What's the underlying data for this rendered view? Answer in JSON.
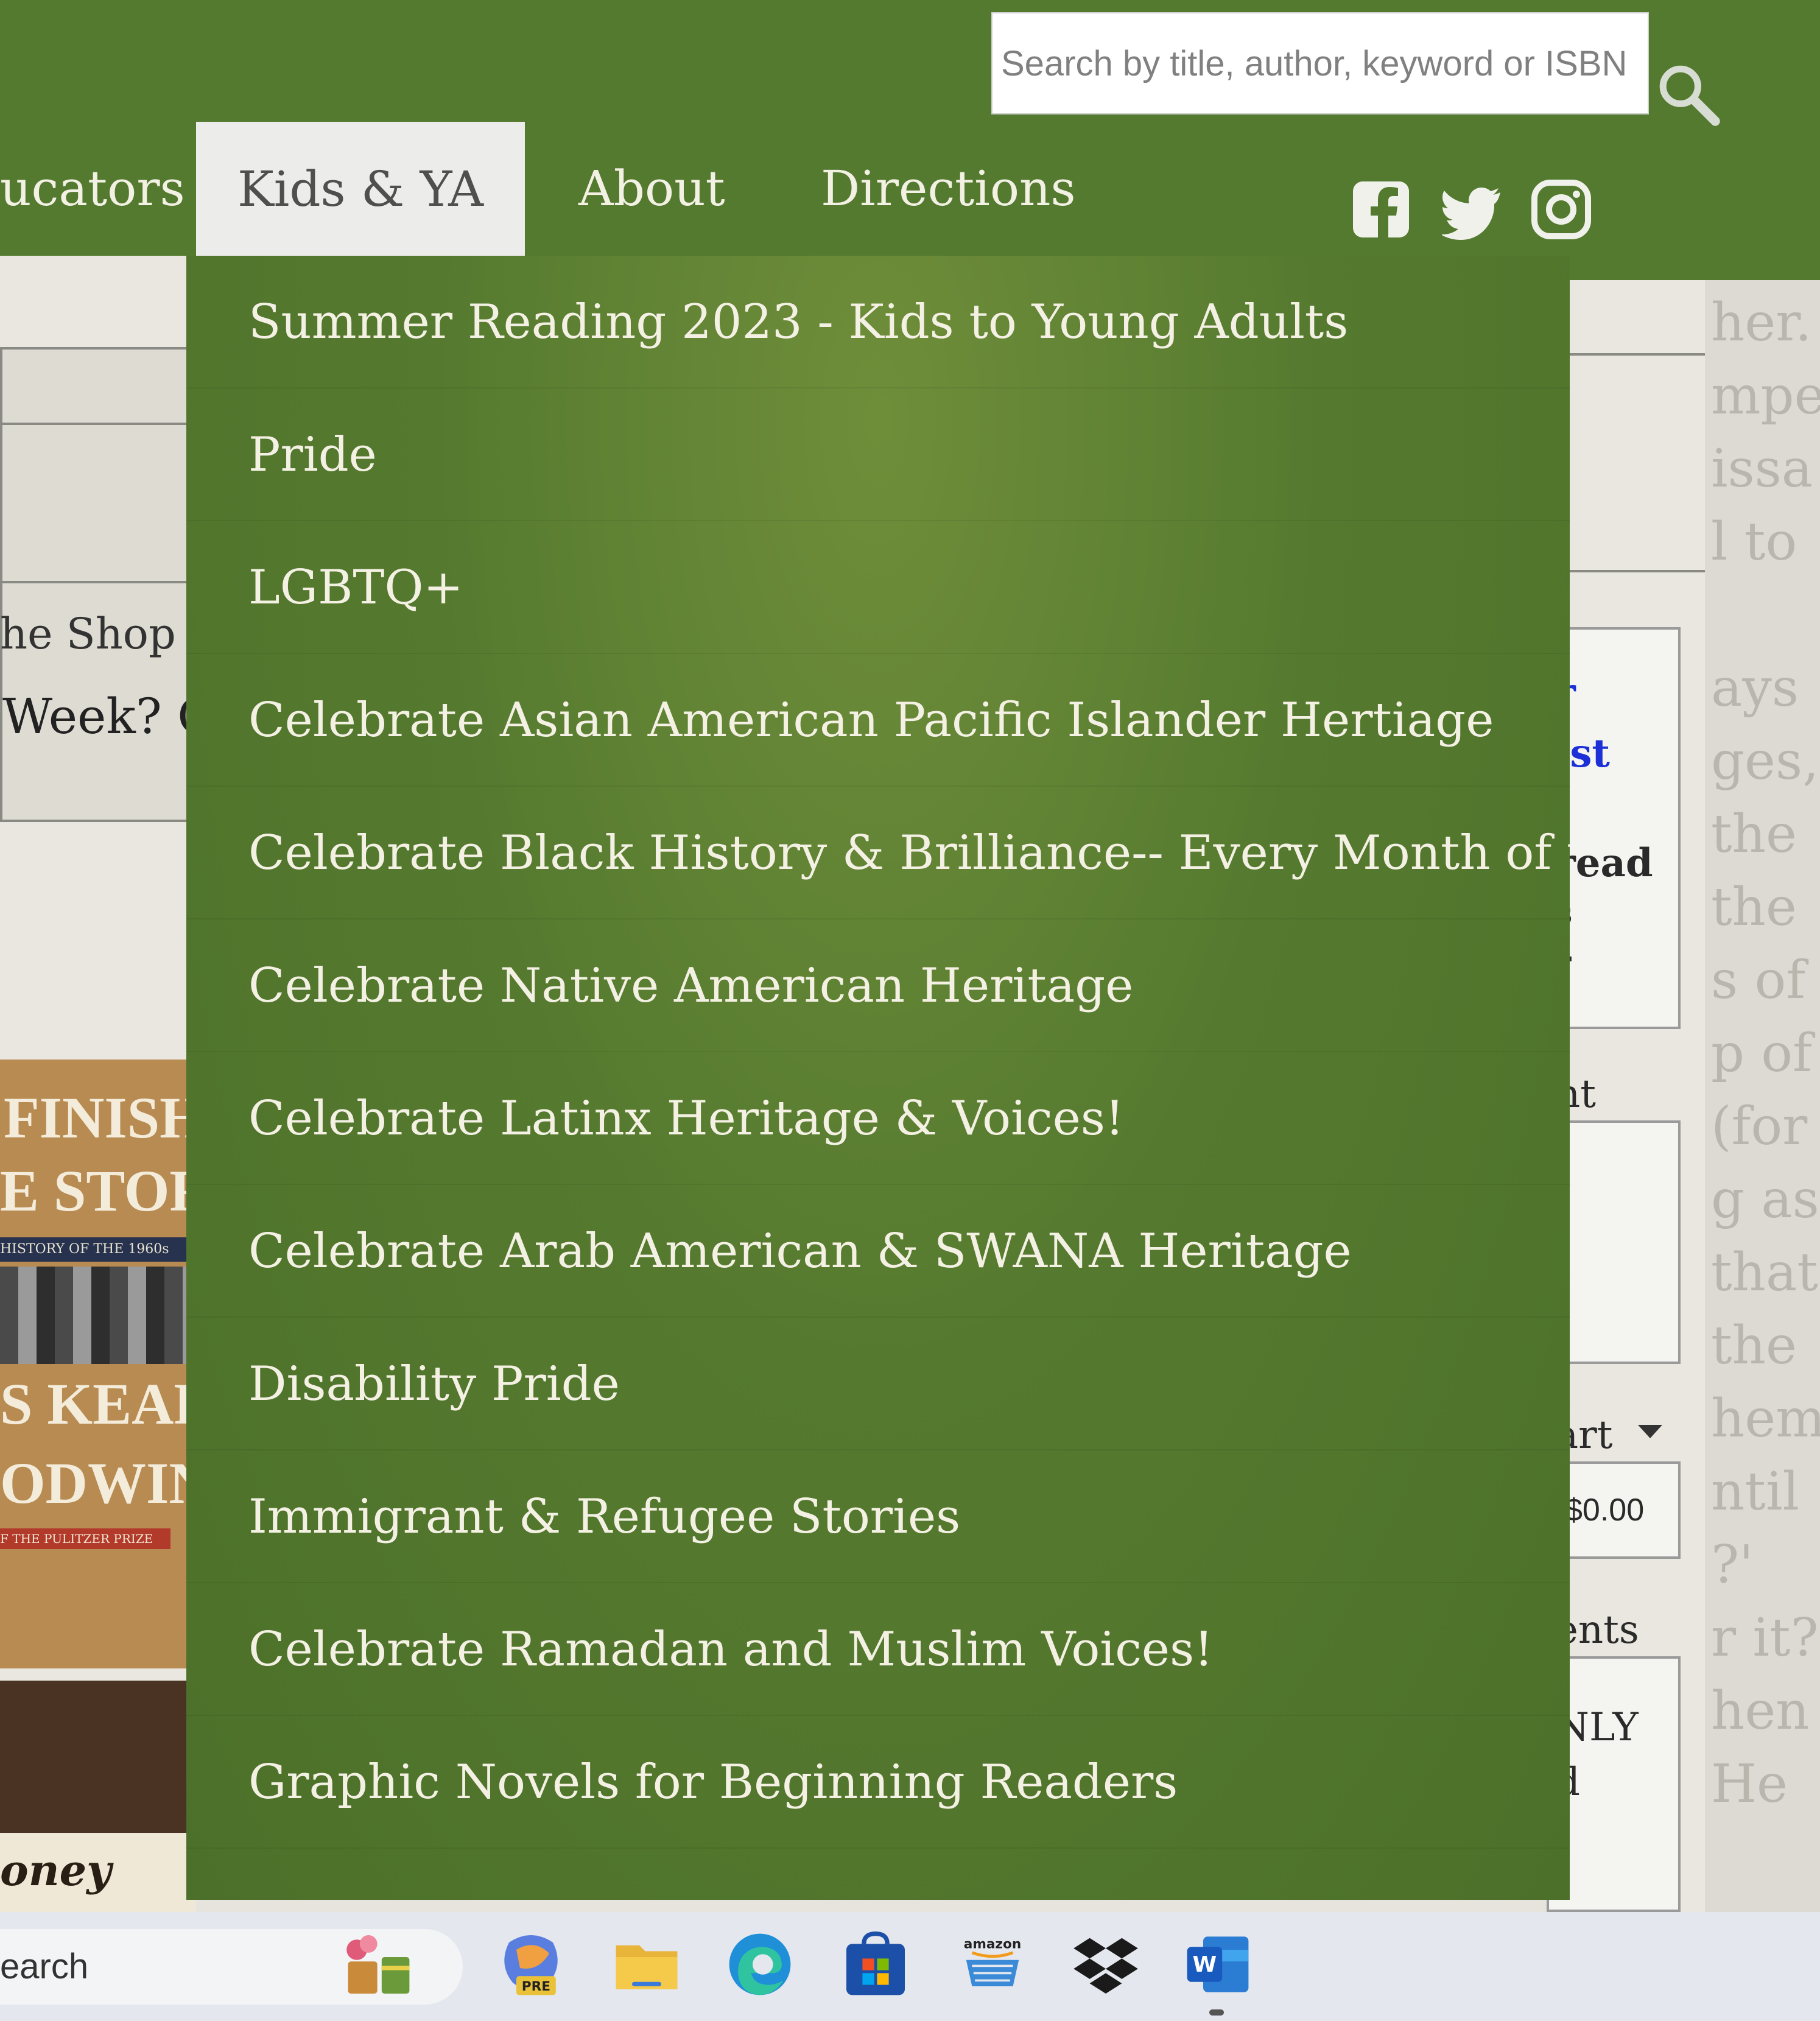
{
  "search": {
    "placeholder": "Search by title, author, keyword or ISBN"
  },
  "nav": {
    "educators": "ucators",
    "kids": "Kids & YA",
    "about": "About",
    "directions": "Directions"
  },
  "social": {
    "icons": [
      "facebook-icon",
      "twitter-icon",
      "instagram-icon"
    ]
  },
  "dropdown": {
    "items": [
      "Summer Reading 2023 - Kids to Young Adults",
      "Pride",
      "LGBTQ+",
      "Celebrate Asian American Pacific Islander Hertiage",
      "Celebrate Black History & Brilliance-- Every Month of the Year!",
      "Celebrate Native American Heritage",
      "Celebrate Latinx Heritage & Voices!",
      "Celebrate Arab American & SWANA Heritage",
      "Disability Pride",
      "Immigrant & Refugee Stories",
      "Celebrate Ramadan and Muslim Voices!",
      "Graphic Novels for Beginning Readers"
    ]
  },
  "background": {
    "left": {
      "the_shop": "he Shop",
      "week": "Week? C",
      "book_lines": [
        "FINISHEI",
        "E STORY",
        "HISTORY OF THE 1960s",
        "S KEARNS",
        "ODWIN",
        "F THE PULITZER PRIZE"
      ],
      "book2": "oney"
    },
    "right": {
      "blue_lines": [
        "r",
        "ist"
      ],
      "lines": [
        "read",
        "s",
        "r",
        "nt",
        "t"
      ],
      "cart": "art",
      "price": "$0.00",
      "ents": "ents",
      "nly": [
        "NLY",
        "d"
      ]
    },
    "far_right": [
      "her.",
      "mpel-",
      "issa",
      "l to",
      "ays",
      "ges,",
      "the",
      "the",
      "s of",
      "p of",
      "(for",
      "g as",
      "that",
      "the",
      "hem",
      "ntil",
      "?'",
      "r it?",
      "hen",
      "He"
    ]
  },
  "taskbar": {
    "search_label": "earch",
    "apps": [
      "widgets-icon",
      "copilot-pre-icon",
      "file-explorer-icon",
      "edge-icon",
      "store-icon",
      "amazon-icon",
      "dropbox-icon",
      "word-icon"
    ]
  },
  "colors": {
    "brand_green": "#537a2f",
    "dropdown_green": "#557a2f",
    "menu_text": "#f4f1e4"
  }
}
